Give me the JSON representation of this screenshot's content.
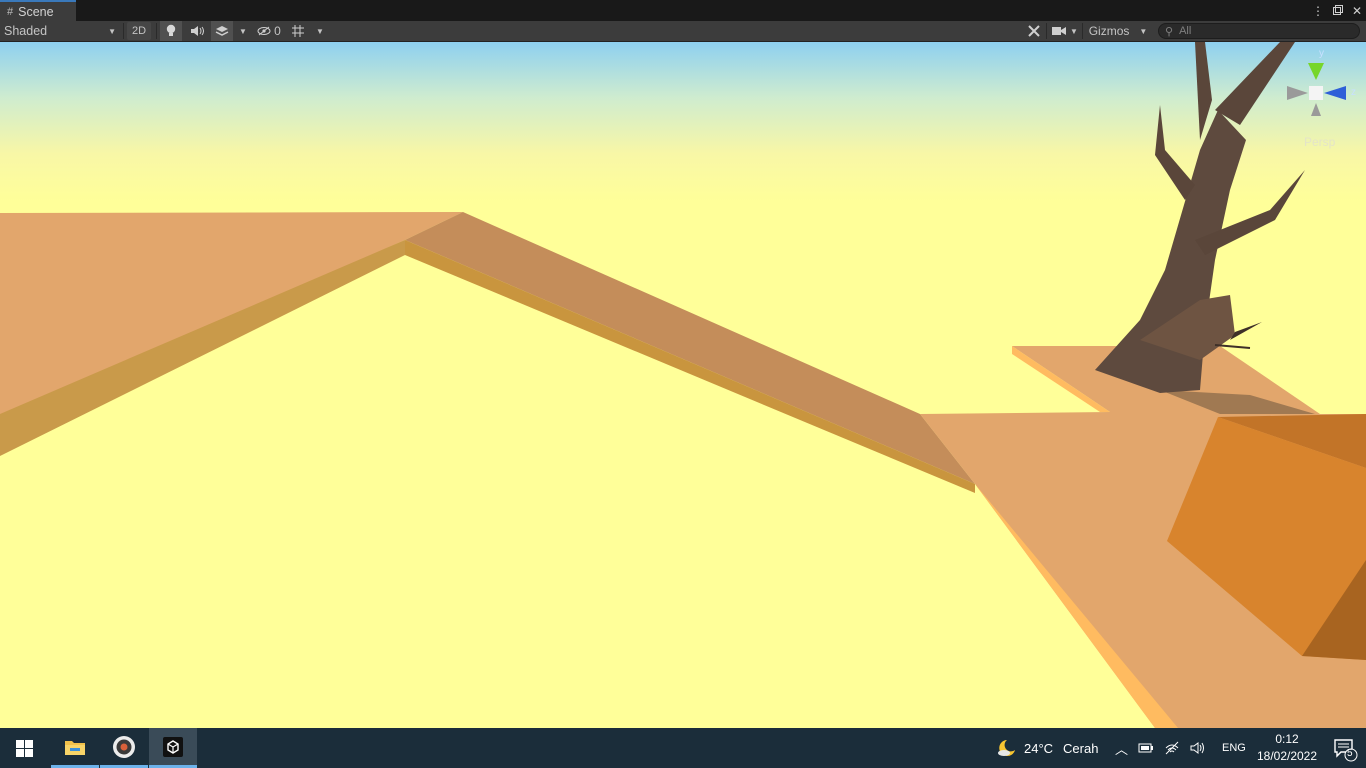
{
  "tab": {
    "icon": "grid-hash-icon",
    "title": "Scene"
  },
  "window_controls": [
    "kebab-menu-icon",
    "maximize-icon",
    "close-icon"
  ],
  "toolbar": {
    "draw_mode": "Shaded",
    "btn_2d": "2D",
    "lighting_icon": "lightbulb-icon",
    "audio_icon": "speaker-icon",
    "effects_icon": "layers-icon",
    "hidden_count": "0",
    "grid_icon": "grid-snap-icon",
    "tools_icon": "tools-icon",
    "camera_icon": "camera-icon",
    "gizmos_label": "Gizmos",
    "search_placeholder": "All"
  },
  "scene": {
    "axis_labels": {
      "y": "y",
      "z": "z"
    },
    "projection_label": "Persp",
    "colors": {
      "sky_top": "#8fd0ee",
      "ground": "#ffff99",
      "platform": "#e2a66c",
      "platform_edge": "#c99a4a",
      "bridge": "#c48d5a",
      "crate": "#d88430",
      "tree": "#5e4a3e"
    }
  },
  "taskbar": {
    "apps": [
      "windows-start-icon",
      "file-explorer-icon",
      "obs-recorder-icon",
      "unity-icon"
    ],
    "weather": {
      "icon": "moon-cloud-icon",
      "temp": "24°C",
      "condition": "Cerah"
    },
    "tray_icons": [
      "chevron-up-icon",
      "battery-icon",
      "wifi-icon",
      "volume-icon"
    ],
    "language": "ENG",
    "time": "0:12",
    "date": "18/02/2022",
    "notification_count": "5"
  }
}
